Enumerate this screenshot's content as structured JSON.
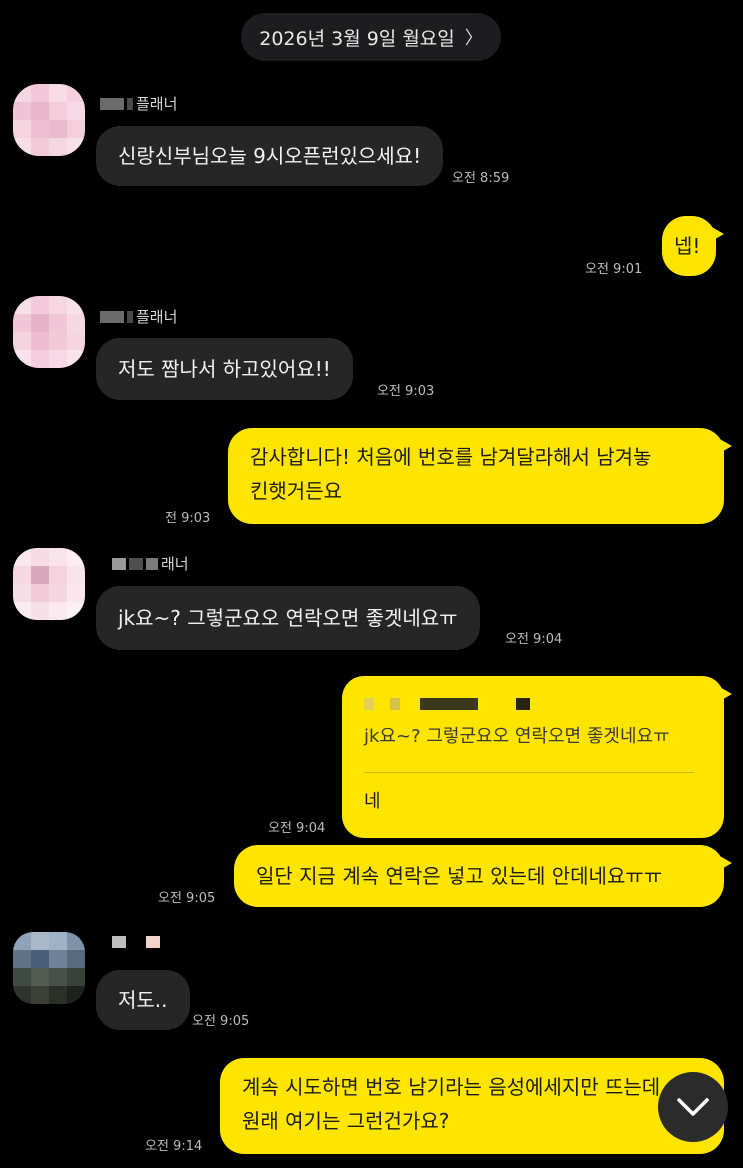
{
  "header": {
    "date": "2026년 3월 9일 월요일",
    "chevron_icon": "chevron-right-icon"
  },
  "messages": [
    {
      "id": "m1",
      "sender": "웨딩플래너",
      "sender_visible": "플래너",
      "text": "신랑신부님오늘 9시오픈런있으세요!",
      "time": "오전 8:59"
    },
    {
      "id": "m2",
      "text": "넵!",
      "time": "오전 9:01"
    },
    {
      "id": "m3",
      "sender_visible": "플래너",
      "text": "저도 짬나서 하고있어요!!",
      "time": "오전 9:03"
    },
    {
      "id": "m4",
      "lines": [
        "감사합니다! 처음에 번호를 남겨달라해서 남겨놓",
        "킨햇거든요"
      ],
      "time": "전 9:03"
    },
    {
      "id": "m5",
      "sender_visible": "래너",
      "text": "jk요~? 그렇군요오 연락오면 좋겟네요ㅠ",
      "time": "오전 9:04"
    },
    {
      "id": "m6",
      "quote": "jk요~? 그렇군요오 연락오면 좋겟네요ㅠ",
      "text": "네",
      "time": "오전 9:04"
    },
    {
      "id": "m7",
      "text": "일단 지금 계속 연락은 넣고 있는데 안데네요ㅠㅠ",
      "time": "오전 9:05"
    },
    {
      "id": "m8",
      "text": "저도..",
      "time": "오전 9:05"
    },
    {
      "id": "m9",
      "lines": [
        "계속 시도하면 번호 남기라는 음성에세지만 뜨는데",
        "원래 여기는 그런건가요?"
      ],
      "time": "오전 9:14"
    }
  ],
  "scroll_button": {
    "icon": "chevron-down-icon"
  },
  "colors": {
    "bubble_out": "#fee500",
    "bubble_in": "#262626",
    "background": "#000000"
  }
}
